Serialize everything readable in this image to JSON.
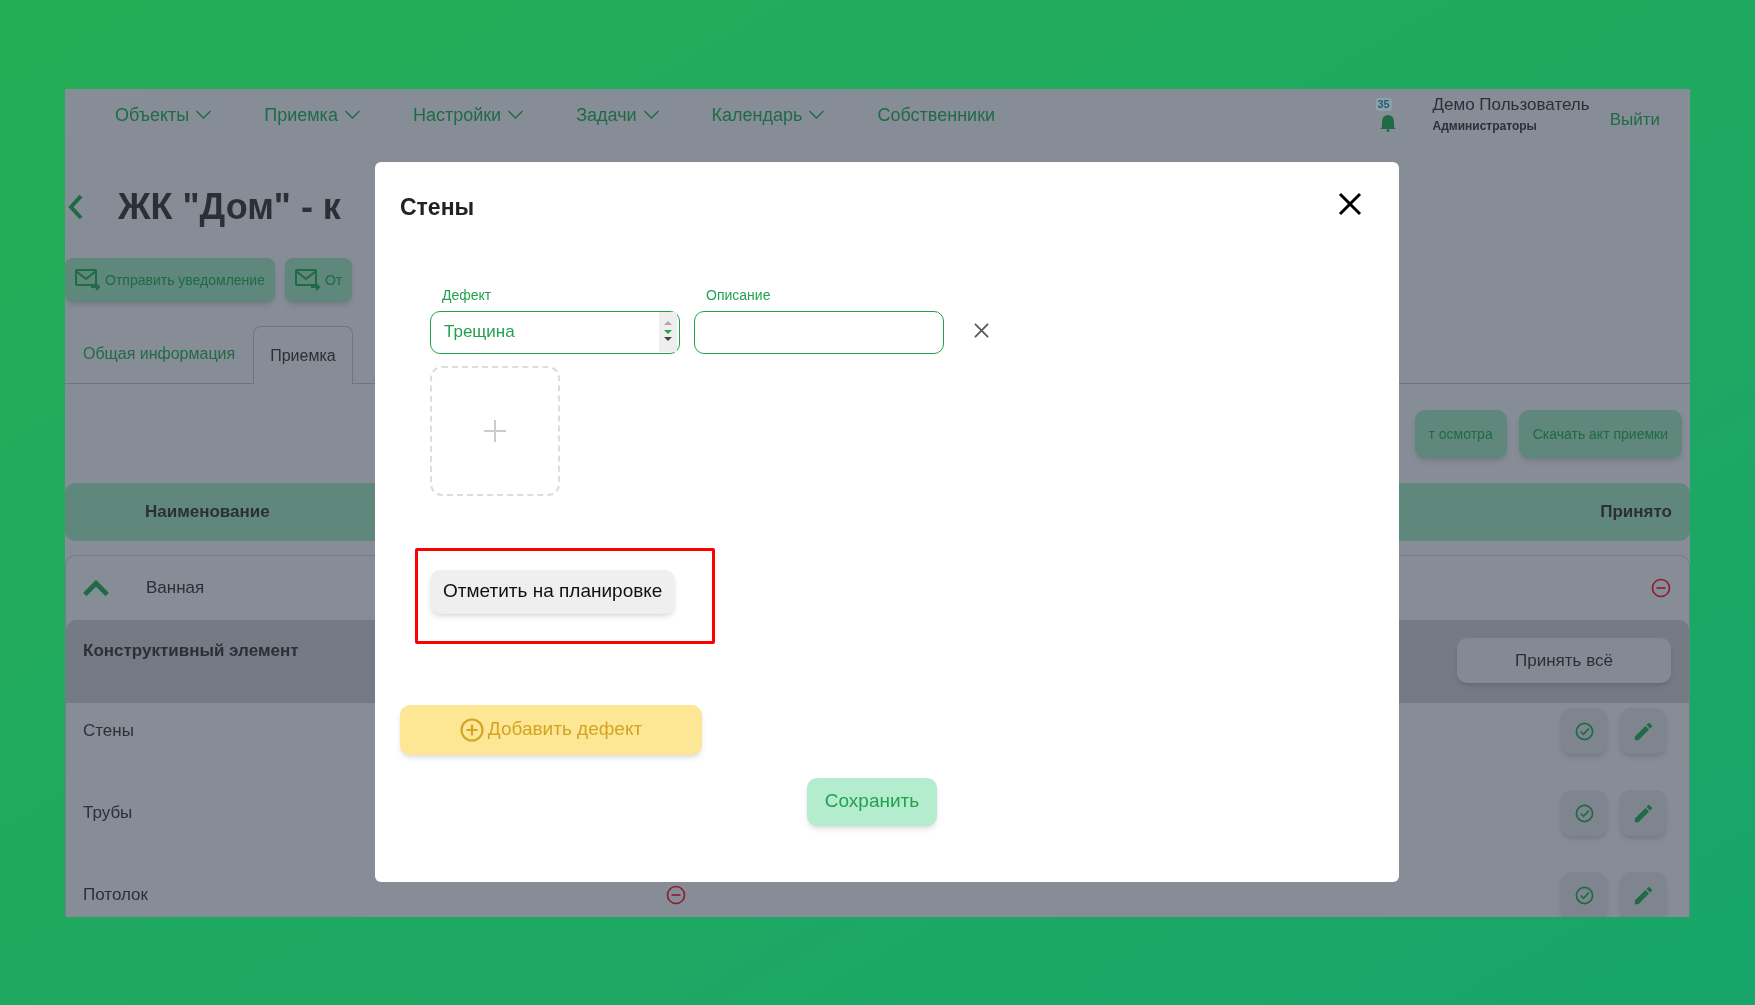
{
  "nav": {
    "items": [
      {
        "label": "Объекты",
        "dropdown": true
      },
      {
        "label": "Приемка",
        "dropdown": true
      },
      {
        "label": "Настройки",
        "dropdown": true
      },
      {
        "label": "Задачи",
        "dropdown": true
      },
      {
        "label": "Календарь",
        "dropdown": true
      },
      {
        "label": "Собственники",
        "dropdown": false
      }
    ],
    "notifications": "35",
    "user_name": "Демо Пользователь",
    "user_role": "Администраторы",
    "logout": "Выйти"
  },
  "page": {
    "title": "ЖК \"Дом\" - к",
    "actions": [
      "Отправить уведомление",
      "От"
    ],
    "tabs": [
      {
        "label": "Общая информация",
        "selected": false
      },
      {
        "label": "Приемка",
        "selected": true
      }
    ],
    "downloads": [
      "т осмотра",
      "Скачать акт приемки"
    ]
  },
  "table": {
    "columns": [
      "Наименование",
      "Принято"
    ],
    "group": {
      "name": "Ванная",
      "expanded": true,
      "declined": true
    },
    "section": {
      "title": "Конструктивный элемент",
      "accept_all": "Принять всё"
    },
    "rows": [
      {
        "name": "Стены"
      },
      {
        "name": "Трубы"
      },
      {
        "name": "Потолок",
        "declined": true
      }
    ]
  },
  "dialog": {
    "title": "Стены",
    "defect_label": "Дефект",
    "defect_value": "Трещина",
    "description_label": "Описание",
    "mark_button": "Отметить на планировке",
    "add_defect": "Добавить дефект",
    "save": "Сохранить"
  }
}
